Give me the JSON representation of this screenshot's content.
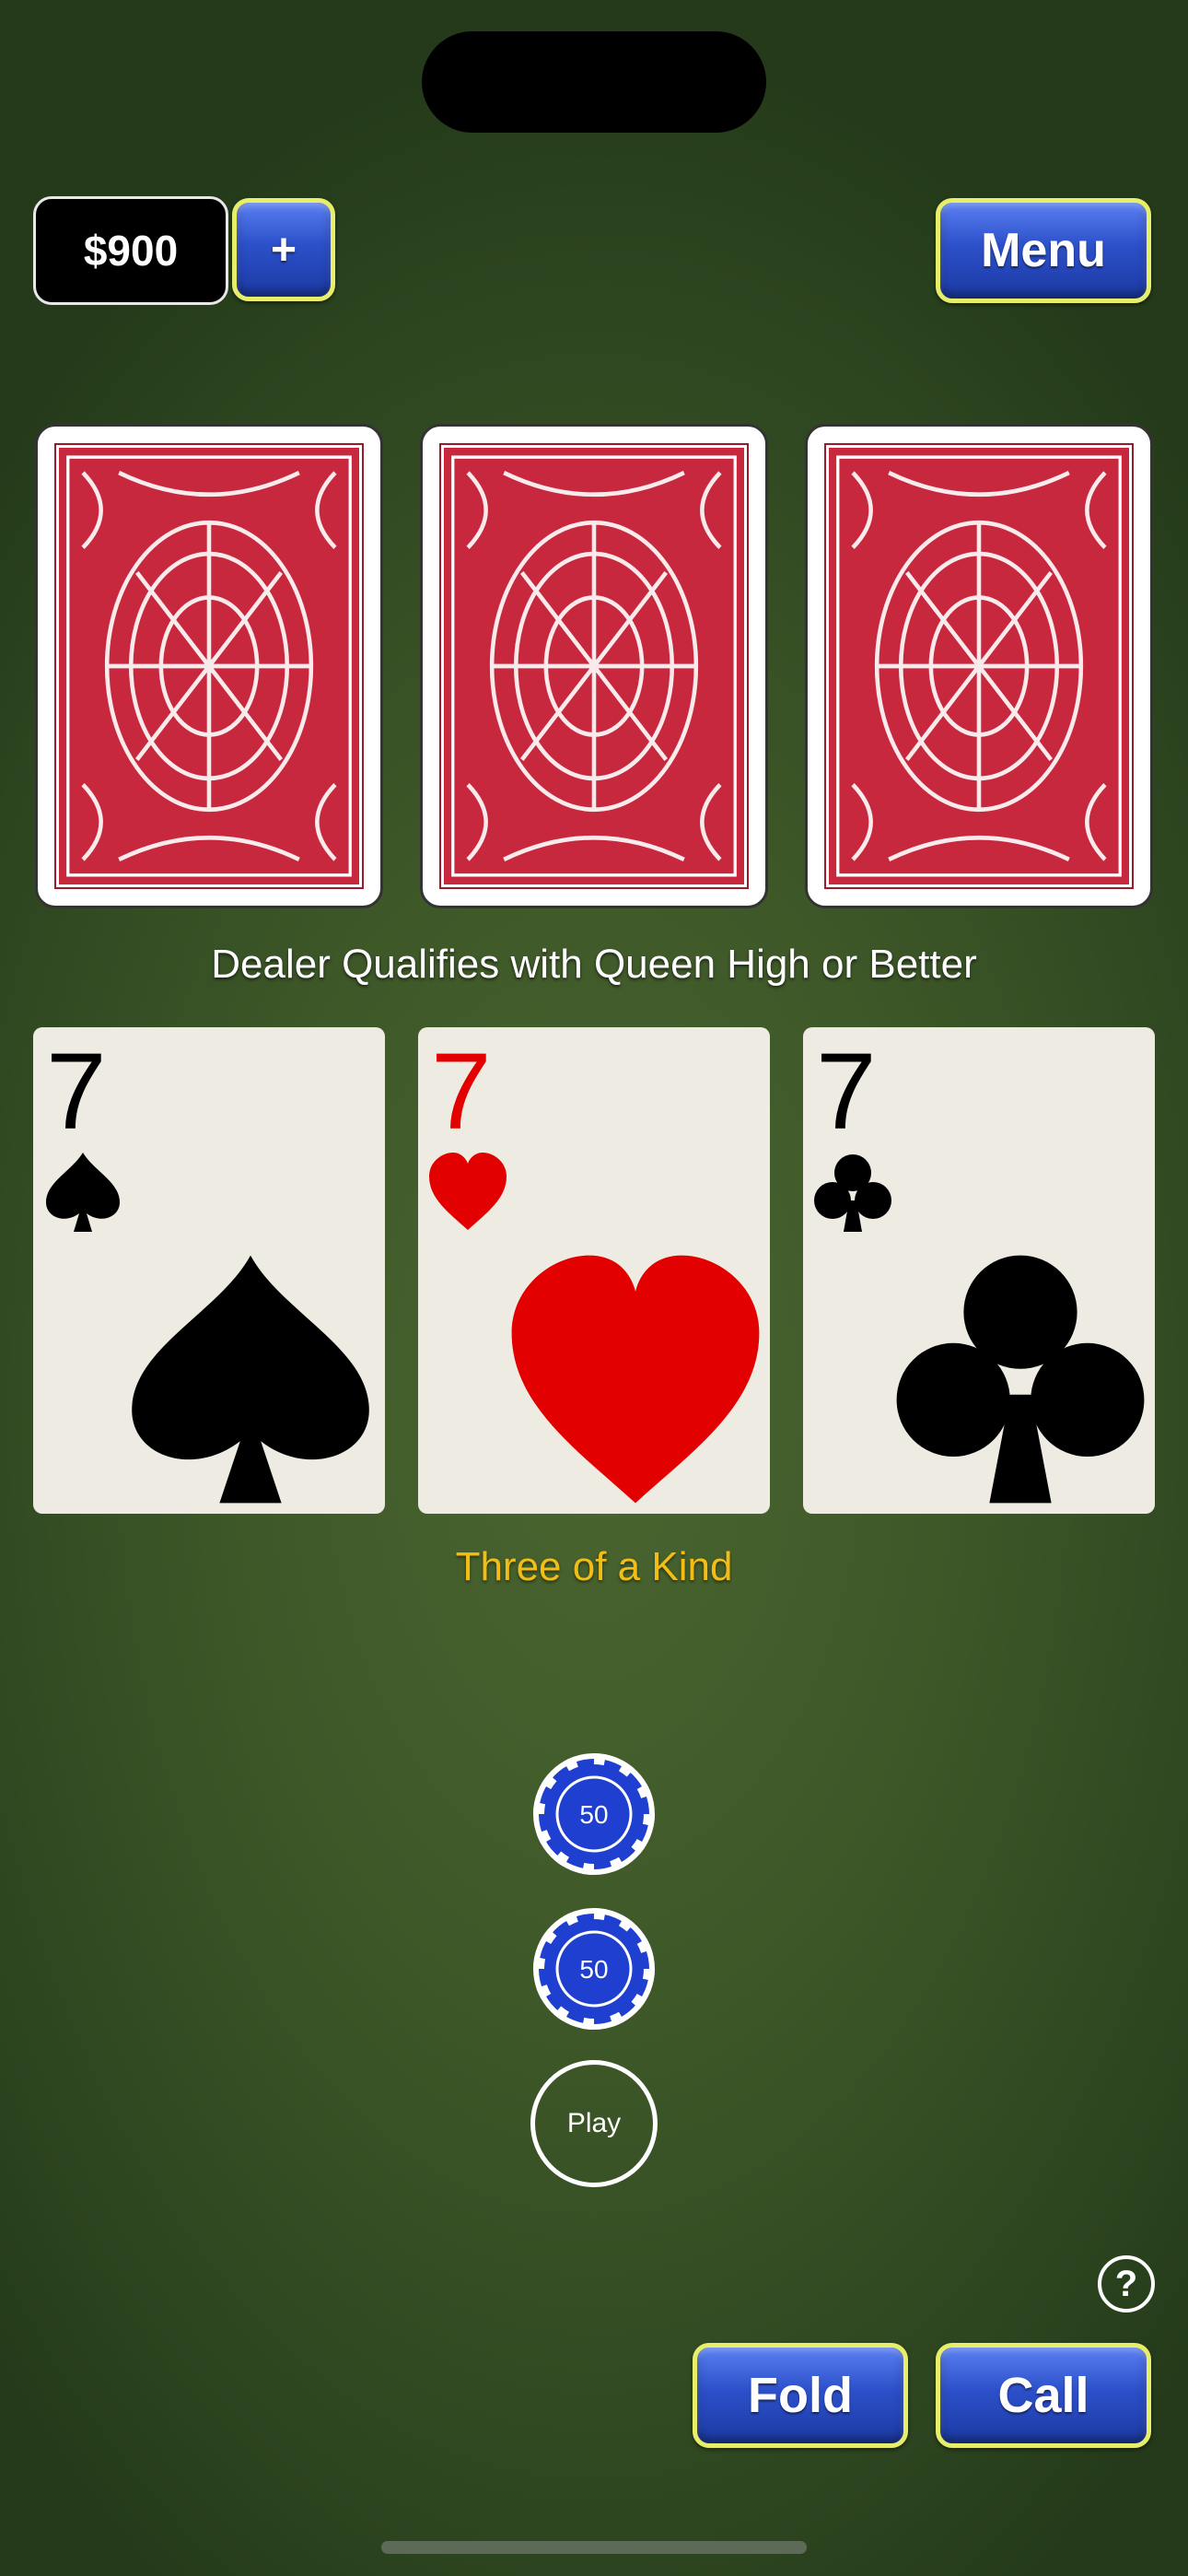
{
  "header": {
    "balance": "$900",
    "add_label": "+",
    "menu_label": "Menu"
  },
  "dealer": {
    "cards": [
      {
        "face": "down",
        "back_color": "#c8283e"
      },
      {
        "face": "down",
        "back_color": "#c8283e"
      },
      {
        "face": "down",
        "back_color": "#c8283e"
      }
    ],
    "qualifier_text": "Dealer Qualifies with Queen High or Better"
  },
  "player": {
    "cards": [
      {
        "rank": "7",
        "suit": "spade-icon",
        "color": "#000000"
      },
      {
        "rank": "7",
        "suit": "heart-icon",
        "color": "#e20000"
      },
      {
        "rank": "7",
        "suit": "club-icon",
        "color": "#000000"
      }
    ],
    "hand_name": "Three of a Kind"
  },
  "bets": {
    "ante_chip": "50",
    "pairplus_chip": "50",
    "play_label": "Play"
  },
  "actions": {
    "help_label": "?",
    "fold_label": "Fold",
    "call_label": "Call"
  },
  "colors": {
    "felt": "#3d5728",
    "button_blue": "#2c50c9",
    "button_border": "#e6ee6a",
    "hand_name": "#f2be16",
    "chip_blue": "#1f3fd0"
  }
}
